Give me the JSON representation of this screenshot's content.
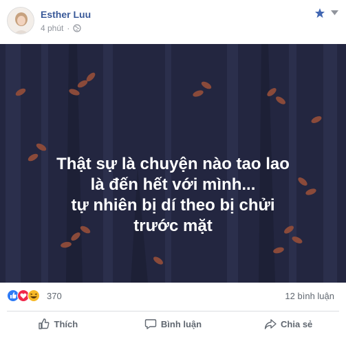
{
  "post": {
    "author_name": "Esther Luu",
    "timestamp": "4 phút",
    "privacy_icon": "globe-icon",
    "status_lines": [
      "Thật sự là chuyện nào tao lao",
      "là đến hết với mình...",
      "tự nhiên bị dí theo bị chửi",
      "trước mặt"
    ],
    "background_color": "#232640",
    "leaf_color": "#8a4a3a"
  },
  "stats": {
    "reactions": [
      "like-icon",
      "love-icon",
      "haha-icon"
    ],
    "reaction_count": "370",
    "comment_count": "12 bình luận"
  },
  "actions": {
    "like_label": "Thích",
    "comment_label": "Bình luận",
    "share_label": "Chia sẻ"
  },
  "colors": {
    "link_blue": "#385898",
    "like_blue": "#2e7bf6",
    "love_red": "#f0284a",
    "haha_yellow": "#f7b928",
    "muted_text": "#606770"
  }
}
